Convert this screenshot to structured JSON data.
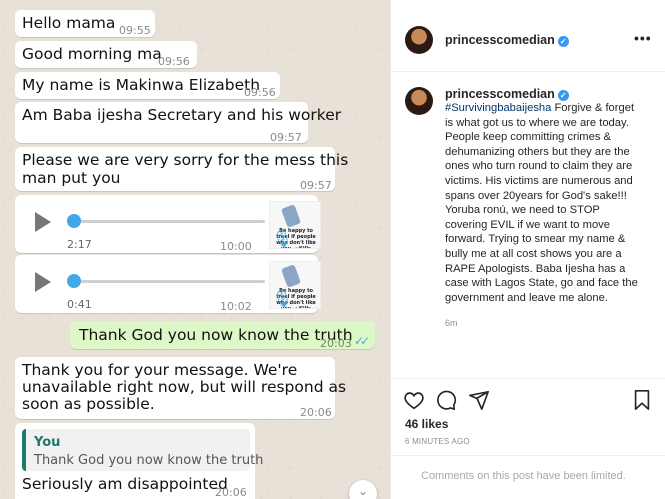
{
  "chat": {
    "messages": [
      {
        "text": "Hello mama",
        "time": "09:55"
      },
      {
        "text": "Good morning ma",
        "time": "09:56"
      },
      {
        "text": "My name is Makinwa Elizabeth",
        "time": "09:56"
      },
      {
        "text": "Am Baba ijesha Secretary and his worker",
        "time": "09:57"
      },
      {
        "line1": "Please we are very sorry for the mess this",
        "line2": "man put you",
        "time": "09:57"
      }
    ],
    "voice_notes": [
      {
        "duration": "2:17",
        "time": "10:00",
        "avatar_caption": "Be happy to freel if people who don't like you. ~Kills Me~"
      },
      {
        "duration": "0:41",
        "time": "10:02",
        "avatar_caption": "Be happy to freel if people who don't like you. ~Kills Me~"
      }
    ],
    "outgoing": {
      "text": "Thank God you now know the truth",
      "time": "20:03",
      "ticks": "✓✓"
    },
    "auto_reply": {
      "line1": "Thank you for your message. We're",
      "line2": "unavailable right now, but will respond as",
      "line3": "soon as possible.",
      "time": "20:06"
    },
    "quoted": {
      "author": "You",
      "quoted_text": "Thank God you now know the truth",
      "text": "Seriously am disappointed",
      "time": "20:06"
    },
    "scroll_icon": "chevron-down-icon"
  },
  "post": {
    "username": "princesscomedian",
    "verified_icon": "check-icon",
    "more_icon": "•••",
    "caption_user": "princesscomedian",
    "caption_lines": [
      "#Survivingbabaijesha Forgive & forget",
      "is what got us to where we are today.",
      "People keep committing crimes &",
      "dehumanizing others but they are the",
      "ones who turn round to claim they are",
      "victims. His victims are numerous and",
      "spans over 20years for God's sake!!!",
      "Yoruba ronú, we need to STOP",
      "covering EVIL if we want to move",
      "forward. Trying to smear my name &",
      "bully me at all cost shows you are a",
      "RAPE Apologists. Baba Ijesha has a",
      "case with Lagos State, go and face the",
      "government and leave me alone."
    ],
    "hashtag": "#Survivingbabaijesha",
    "caption_age": "6m",
    "likes": "46 likes",
    "timestamp": "6 MINUTES AGO",
    "comments_limited": "Comments on this post have been limited.",
    "icons": {
      "like": "heart-icon",
      "comment": "comment-icon",
      "share": "share-icon",
      "save": "bookmark-icon"
    },
    "colors": {
      "verified": "#3897f0",
      "hashtag": "#00376b"
    }
  }
}
